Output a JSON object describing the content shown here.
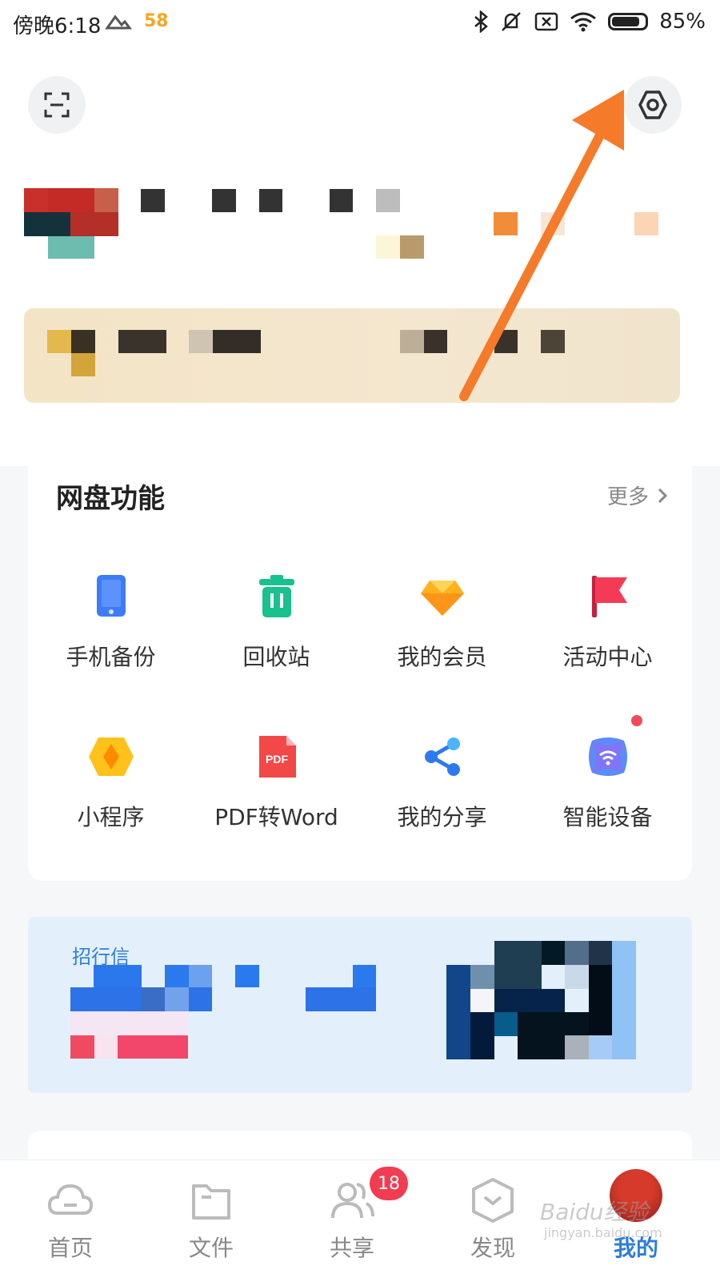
{
  "status_bar": {
    "time": "傍晚6:18",
    "app_badge": "58",
    "battery": "85%",
    "battery_level": 0.85
  },
  "header": {
    "scan_icon": "scan-icon",
    "settings_icon": "settings-icon"
  },
  "functions": {
    "title": "网盘功能",
    "more": "更多",
    "items": [
      {
        "label": "手机备份",
        "icon": "phone-backup-icon",
        "color": "#3d7cf5"
      },
      {
        "label": "回收站",
        "icon": "recycle-bin-icon",
        "color": "#19c18f"
      },
      {
        "label": "我的会员",
        "icon": "vip-diamond-icon",
        "color": "#ffb21e"
      },
      {
        "label": "活动中心",
        "icon": "flag-icon",
        "color": "#f53a57"
      },
      {
        "label": "小程序",
        "icon": "mini-program-icon",
        "color": "#ffc21a"
      },
      {
        "label": "PDF转Word",
        "icon": "pdf-icon",
        "color": "#f24848"
      },
      {
        "label": "我的分享",
        "icon": "share-icon",
        "color": "#2d7af0"
      },
      {
        "label": "智能设备",
        "icon": "smart-device-icon",
        "color": "#5b8cf7"
      }
    ]
  },
  "promo": {
    "text": "招行信"
  },
  "bottom_nav": {
    "items": [
      {
        "label": "首页",
        "icon": "cloud-icon"
      },
      {
        "label": "文件",
        "icon": "folder-icon"
      },
      {
        "label": "共享",
        "icon": "people-icon"
      },
      {
        "label": "发现",
        "icon": "discover-icon"
      },
      {
        "label": "我的",
        "icon": "avatar"
      }
    ],
    "share_badge": "18",
    "active_index": 4
  },
  "watermark": {
    "main": "Baidu经验",
    "sub": "jingyan.baidu.com"
  }
}
